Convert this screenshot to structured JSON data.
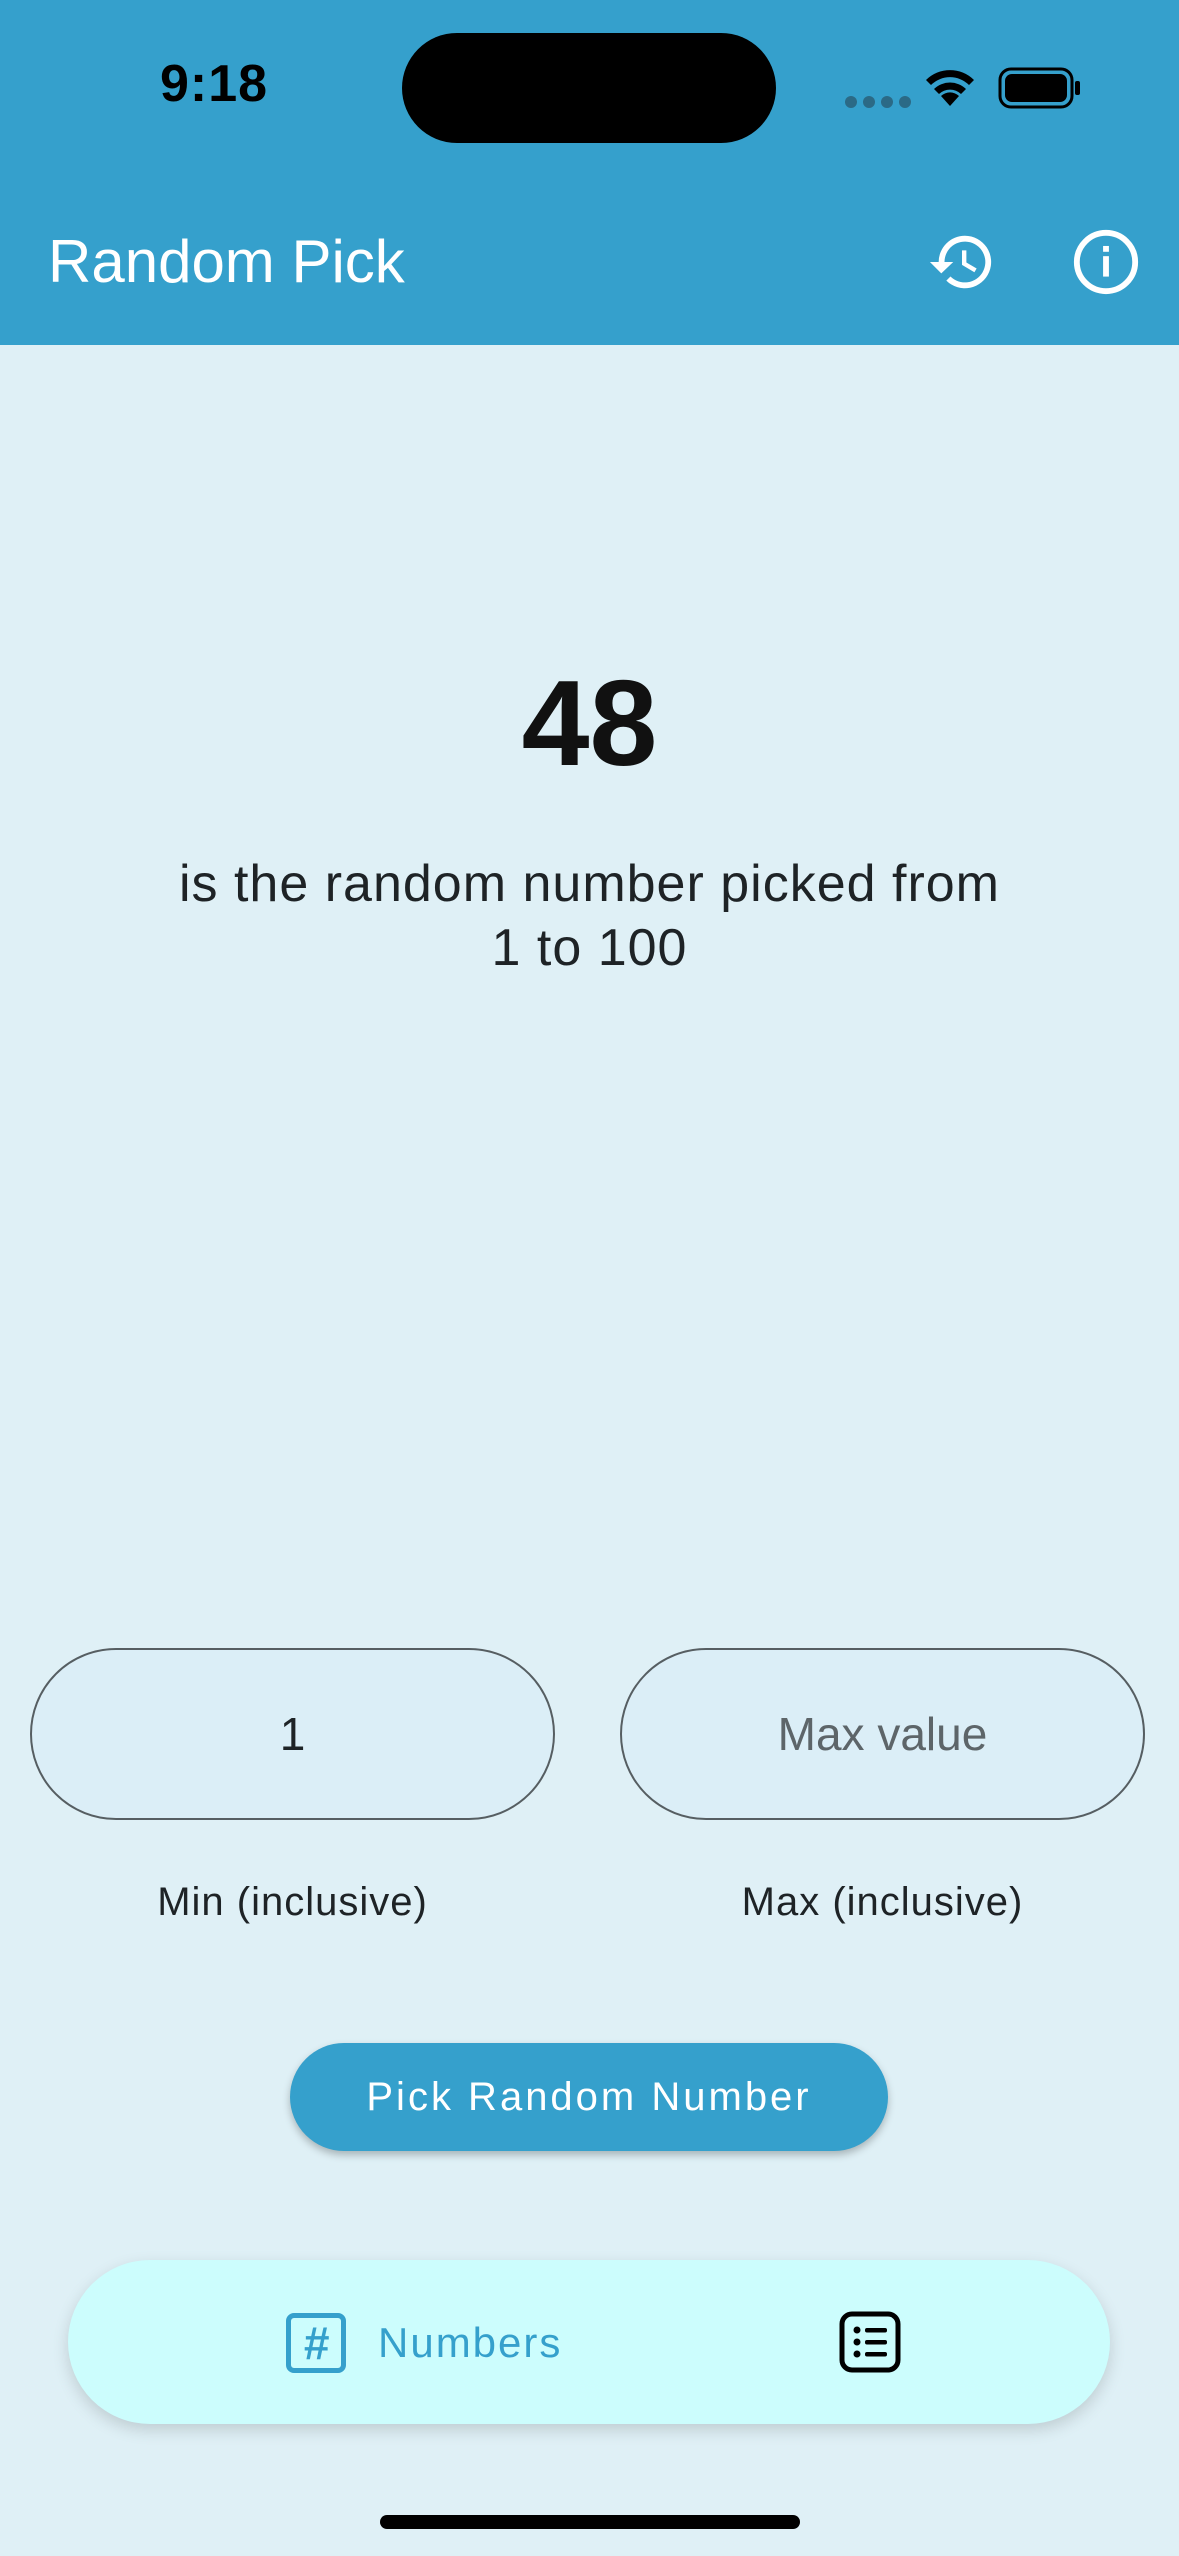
{
  "status_bar": {
    "time": "9:18"
  },
  "app_bar": {
    "title": "Random Pick",
    "history_icon": "history-icon",
    "info_icon": "info-icon"
  },
  "result": {
    "number": "48",
    "description": "is the random number picked from",
    "range_text": "1 to 100"
  },
  "inputs": {
    "min_value": "1",
    "min_label": "Min (inclusive)",
    "max_value": "",
    "max_placeholder": "Max value",
    "max_label": "Max (inclusive)"
  },
  "pick_button": {
    "label": "Pick Random Number"
  },
  "bottom_nav": {
    "items": [
      {
        "label": "Numbers",
        "icon": "hash-icon",
        "selected": true
      },
      {
        "label": "",
        "icon": "list-icon",
        "selected": false
      }
    ]
  },
  "colors": {
    "primary": "#35a0cc",
    "background": "#dff0f6",
    "nav_background": "#ccfdfd"
  }
}
